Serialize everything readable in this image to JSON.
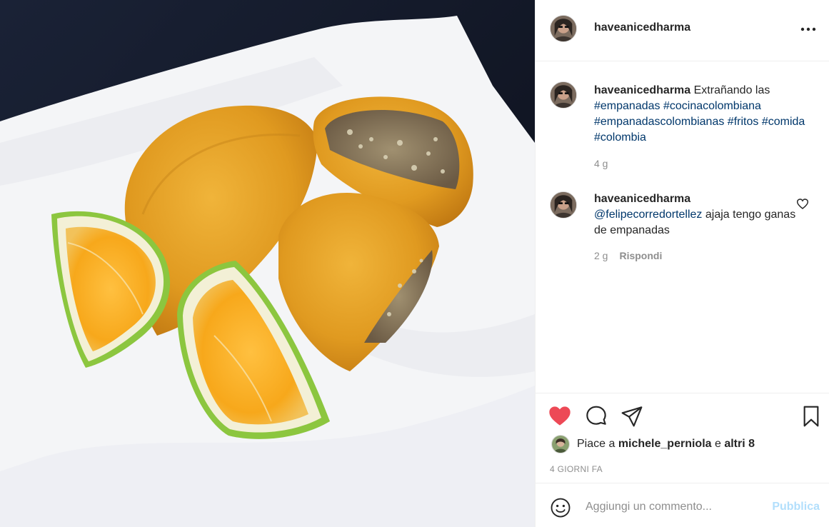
{
  "post": {
    "image_alt": "empanadas-with-orange-slices"
  },
  "header": {
    "username": "haveanicedharma",
    "more_icon": "more-horizontal-icon"
  },
  "caption": {
    "username": "haveanicedharma",
    "text": " Extrañando las",
    "hashtags": [
      "#empanadas",
      "#cocinacolombiana",
      "#empanadascolombianas",
      "#fritos",
      "#comida",
      "#colombia"
    ],
    "time": "4 g"
  },
  "comment": {
    "username": "haveanicedharma",
    "mention": "@felipecorredortellez",
    "text": " ajaja tengo ganas de empanadas",
    "time": "2 g",
    "reply_label": "Rispondi"
  },
  "actions": {
    "like_icon": "heart-filled-icon",
    "comment_icon": "speech-bubble-icon",
    "share_icon": "paper-plane-icon",
    "save_icon": "bookmark-icon",
    "like_color": "#ed4956"
  },
  "likes": {
    "prefix": "Piace a ",
    "user": "michele_perniola",
    "connector": " e ",
    "others": "altri 8"
  },
  "date_label": "4 GIORNI FA",
  "add_comment": {
    "placeholder": "Aggiungi un commento...",
    "publish_label": "Pubblica",
    "publish_color": "#b2dffc"
  }
}
